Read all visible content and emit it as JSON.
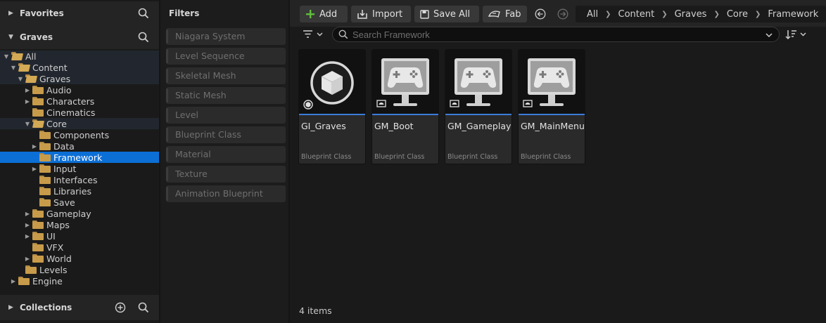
{
  "left_panel": {
    "favorites": "Favorites",
    "root": "Graves",
    "collections": "Collections",
    "tree": [
      {
        "label": "All",
        "depth": 0,
        "arrow": "down",
        "open": true,
        "state": "path"
      },
      {
        "label": "Content",
        "depth": 1,
        "arrow": "down",
        "open": true,
        "state": "path"
      },
      {
        "label": "Graves",
        "depth": 2,
        "arrow": "down",
        "open": true,
        "state": "path"
      },
      {
        "label": "Audio",
        "depth": 3,
        "arrow": "right",
        "open": false,
        "state": ""
      },
      {
        "label": "Characters",
        "depth": 3,
        "arrow": "right",
        "open": false,
        "state": ""
      },
      {
        "label": "Cinematics",
        "depth": 3,
        "arrow": "",
        "open": false,
        "state": ""
      },
      {
        "label": "Core",
        "depth": 3,
        "arrow": "down",
        "open": true,
        "state": "path"
      },
      {
        "label": "Components",
        "depth": 4,
        "arrow": "",
        "open": false,
        "state": ""
      },
      {
        "label": "Data",
        "depth": 4,
        "arrow": "right",
        "open": false,
        "state": ""
      },
      {
        "label": "Framework",
        "depth": 4,
        "arrow": "",
        "open": false,
        "state": "selected"
      },
      {
        "label": "Input",
        "depth": 4,
        "arrow": "right",
        "open": false,
        "state": ""
      },
      {
        "label": "Interfaces",
        "depth": 4,
        "arrow": "",
        "open": false,
        "state": ""
      },
      {
        "label": "Libraries",
        "depth": 4,
        "arrow": "",
        "open": false,
        "state": ""
      },
      {
        "label": "Save",
        "depth": 4,
        "arrow": "",
        "open": false,
        "state": ""
      },
      {
        "label": "Gameplay",
        "depth": 3,
        "arrow": "right",
        "open": false,
        "state": ""
      },
      {
        "label": "Maps",
        "depth": 3,
        "arrow": "right",
        "open": false,
        "state": ""
      },
      {
        "label": "UI",
        "depth": 3,
        "arrow": "right",
        "open": false,
        "state": ""
      },
      {
        "label": "VFX",
        "depth": 3,
        "arrow": "",
        "open": false,
        "state": ""
      },
      {
        "label": "World",
        "depth": 3,
        "arrow": "right",
        "open": false,
        "state": ""
      },
      {
        "label": "Levels",
        "depth": 2,
        "arrow": "",
        "open": false,
        "state": ""
      },
      {
        "label": "Engine",
        "depth": 1,
        "arrow": "right",
        "open": false,
        "state": ""
      }
    ]
  },
  "filters": {
    "title": "Filters",
    "items": [
      "Niagara System",
      "Level Sequence",
      "Skeletal Mesh",
      "Static Mesh",
      "Level",
      "Blueprint Class",
      "Material",
      "Texture",
      "Animation Blueprint"
    ]
  },
  "toolbar": {
    "add": "Add",
    "import": "Import",
    "save_all": "Save All",
    "fab": "Fab",
    "breadcrumb": [
      "All",
      "Content",
      "Graves",
      "Core",
      "Framework"
    ]
  },
  "search": {
    "placeholder": "Search Framework"
  },
  "assets": [
    {
      "name": "GI_Graves",
      "type": "Blueprint Class",
      "thumb": "cube-icon"
    },
    {
      "name": "GM_Boot",
      "type": "Blueprint Class",
      "thumb": "gamemode-icon"
    },
    {
      "name": "GM_Gameplay",
      "type": "Blueprint Class",
      "thumb": "gamemode-icon"
    },
    {
      "name": "GM_MainMenu",
      "type": "Blueprint Class",
      "thumb": "gamemode-icon"
    }
  ],
  "status": {
    "count": "4 items"
  },
  "colors": {
    "selection": "#0c6fd6",
    "asset_underline": "#3b7bd9",
    "add_icon": "#5fbf3a",
    "folder": "#c79b4a"
  }
}
